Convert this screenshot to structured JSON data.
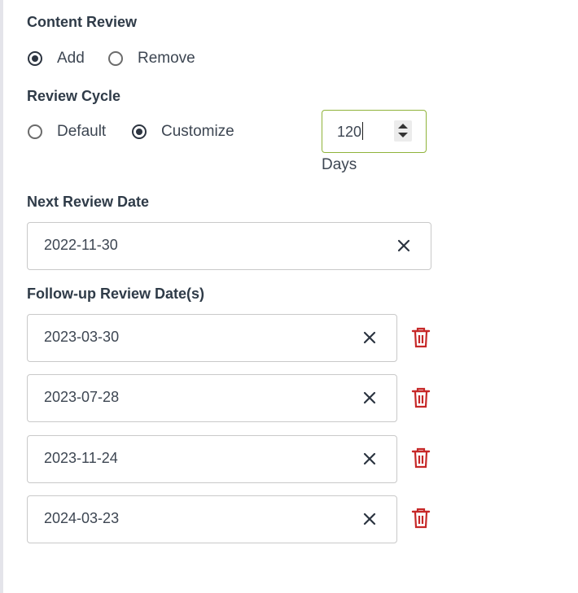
{
  "content_review": {
    "label": "Content Review",
    "options": [
      {
        "label": "Add",
        "checked": true
      },
      {
        "label": "Remove",
        "checked": false
      }
    ]
  },
  "review_cycle": {
    "label": "Review Cycle",
    "options": [
      {
        "label": "Default",
        "checked": false
      },
      {
        "label": "Customize",
        "checked": true
      }
    ],
    "days_value": "120",
    "days_unit": "Days"
  },
  "next_review": {
    "label": "Next Review Date",
    "value": "2022-11-30"
  },
  "followup": {
    "label": "Follow-up Review Date(s)",
    "dates": [
      "2023-03-30",
      "2023-07-28",
      "2023-11-24",
      "2024-03-23"
    ]
  },
  "icons": {
    "clear": "close-icon",
    "delete": "trash-icon",
    "spinner_up": "chevron-up-icon",
    "spinner_down": "chevron-down-icon"
  },
  "colors": {
    "focus_border": "#8fb33a",
    "delete": "#c62828",
    "text": "#2f3b48"
  }
}
